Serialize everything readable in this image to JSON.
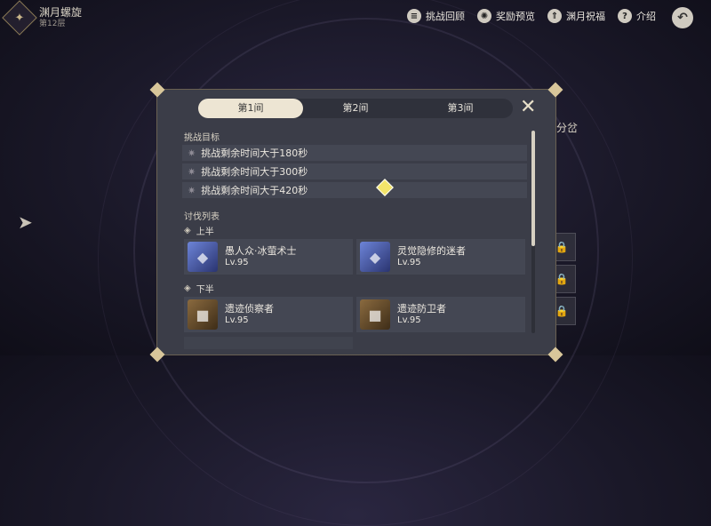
{
  "header": {
    "title": "渊月螺旋",
    "subtitle": "第12层"
  },
  "topnav": [
    {
      "label": "挑战回顾",
      "icon": "book-icon"
    },
    {
      "label": "奖励预览",
      "icon": "gear-icon"
    },
    {
      "label": "渊月祝福",
      "icon": "blessing-icon"
    },
    {
      "label": "介绍",
      "icon": "help-icon"
    }
  ],
  "background": {
    "side_text": "分岔"
  },
  "panel": {
    "tabs": [
      "第1间",
      "第2间",
      "第3间"
    ],
    "active_tab": 0,
    "goals_title": "挑战目标",
    "goals": [
      "挑战剩余时间大于180秒",
      "挑战剩余时间大于300秒",
      "挑战剩余时间大于420秒"
    ],
    "enemies_title": "讨伐列表",
    "first_half_label": "上半",
    "second_half_label": "下半",
    "first_half": [
      {
        "name": "愚人众·冰萤术士",
        "level": "Lv.95"
      },
      {
        "name": "灵觉隐修的迷者",
        "level": "Lv.95"
      }
    ],
    "second_half": [
      {
        "name": "遗迹侦察者",
        "level": "Lv.95"
      },
      {
        "name": "遗迹防卫者",
        "level": "Lv.95"
      }
    ]
  }
}
